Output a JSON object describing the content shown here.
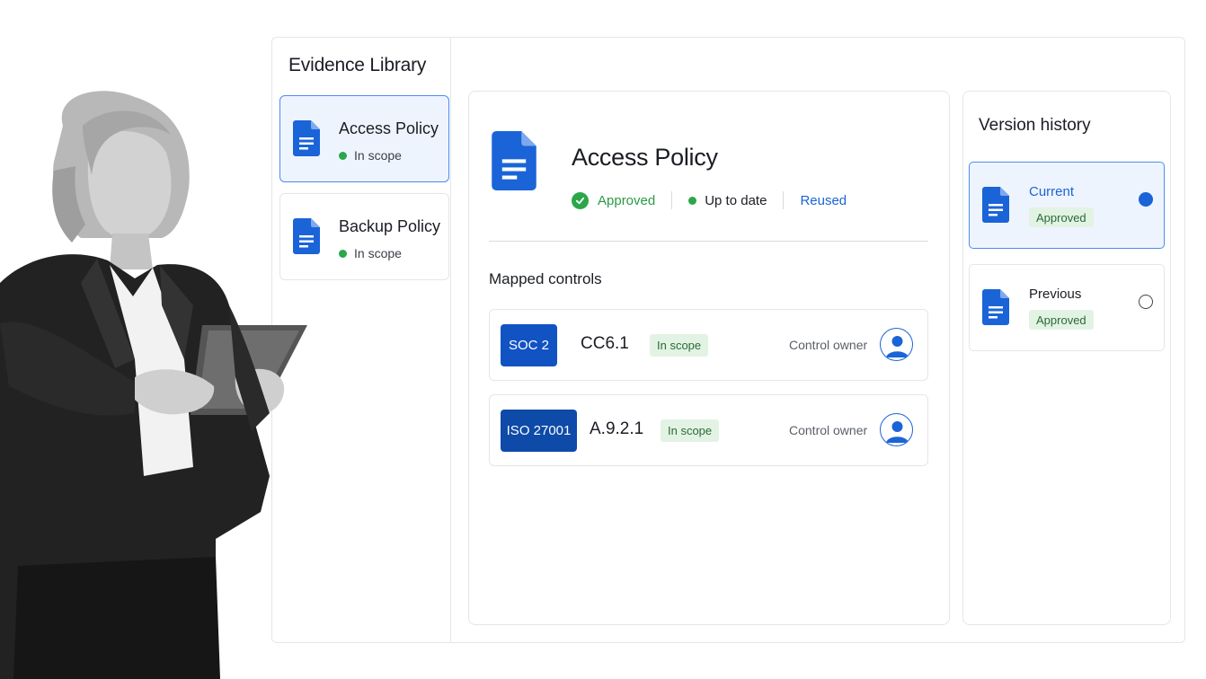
{
  "sidebar": {
    "title": "Evidence Library",
    "items": [
      {
        "name": "Access Policy",
        "status": "In scope",
        "selected": true
      },
      {
        "name": "Backup Policy",
        "status": "In scope",
        "selected": false
      }
    ]
  },
  "detail": {
    "title": "Access Policy",
    "statuses": {
      "approved": "Approved",
      "freshness": "Up to date",
      "reuse": "Reused"
    },
    "mapped_title": "Mapped controls",
    "controls": [
      {
        "framework": "SOC 2",
        "control_id": "CC6.1",
        "scope": "In scope",
        "owner_label": "Control owner"
      },
      {
        "framework": "ISO 27001",
        "control_id": "A.9.2.1",
        "scope": "In scope",
        "owner_label": "Control owner"
      }
    ]
  },
  "history": {
    "title": "Version history",
    "versions": [
      {
        "label": "Current",
        "status": "Approved",
        "selected": true
      },
      {
        "label": "Previous",
        "status": "Approved",
        "selected": false
      }
    ]
  },
  "icons": {
    "document": "document-icon",
    "check": "check-circle-icon",
    "avatar": "user-avatar-icon",
    "radio_on": "radio-selected-icon",
    "radio_off": "radio-unselected-icon"
  },
  "colors": {
    "accent": "#1a64d8",
    "selected_bg": "#eef4fe",
    "success": "#2aa74a",
    "badge_bg": "#e2f3e4",
    "framework_bg": "#1253c4"
  }
}
